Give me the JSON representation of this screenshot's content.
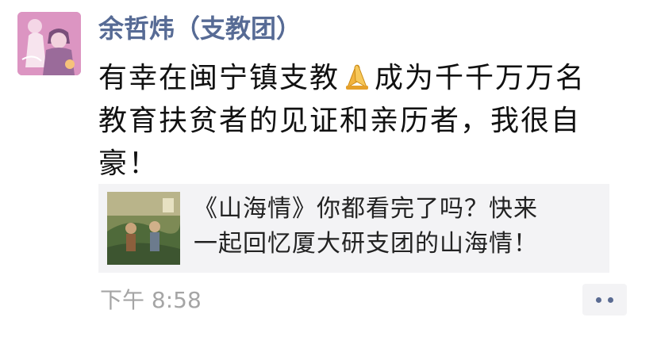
{
  "post": {
    "author": "余哲炜（支教团）",
    "content_lines": [
      "有幸在闽宁镇支教",
      "成为千千万万名",
      "教育扶贫者的见证和亲历者，我很自",
      "豪！"
    ],
    "emoji": "pray-hands-icon",
    "shared_link": {
      "lines": [
        "《山海情》你都看完了吗？快来",
        "一起回忆厦大研支团的山海情！"
      ]
    },
    "timestamp": "下午 8:58"
  },
  "colors": {
    "author_name": "#576b95",
    "timestamp": "#a5a5a5",
    "share_bg": "#f3f3f5",
    "more_dots": "#5a6b92"
  }
}
